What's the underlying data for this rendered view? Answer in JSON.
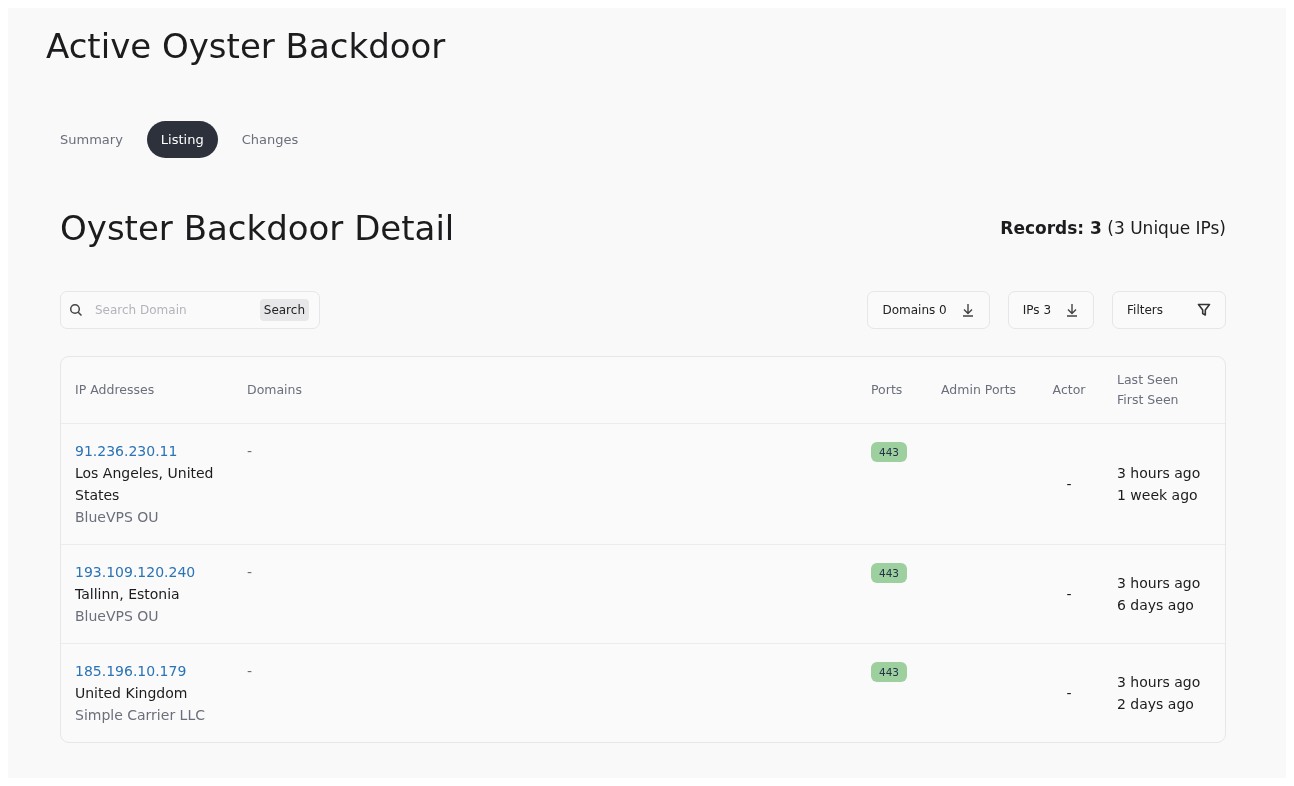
{
  "page_title": "Active Oyster Backdoor",
  "tabs": [
    {
      "label": "Summary",
      "selected": false
    },
    {
      "label": "Listing",
      "selected": true
    },
    {
      "label": "Changes",
      "selected": false
    }
  ],
  "section_title": "Oyster Backdoor Detail",
  "records": "**Records: 3** (3 Unique IPs)",
  "search": {
    "placeholder": "Search Domain",
    "button": "Search"
  },
  "actions": [
    {
      "label": "Domains 0",
      "kind": "download"
    },
    {
      "label": "IPs 3",
      "kind": "download"
    },
    {
      "label": "Filters",
      "kind": "filter"
    }
  ],
  "table": {
    "columns": [
      {
        "label": "IP Addresses"
      },
      {
        "label": "Domains"
      },
      {
        "label": "Ports"
      },
      {
        "label": "Admin Ports"
      },
      {
        "label": "Actor"
      },
      {
        "label": "Last Seen",
        "sublabel": "First Seen"
      }
    ],
    "rows": [
      {
        "ip": "91.236.230.11",
        "location": "Los Angeles, United States",
        "provider": "BlueVPS OU",
        "domains": "-",
        "ports": [
          "443"
        ],
        "actor": "-",
        "last_seen": "3 hours ago",
        "first_seen": "1 week ago"
      },
      {
        "ip": "193.109.120.240",
        "location": "Tallinn, Estonia",
        "provider": "BlueVPS OU",
        "domains": "-",
        "ports": [
          "443"
        ],
        "actor": "-",
        "last_seen": "3 hours ago",
        "first_seen": "6 days ago"
      },
      {
        "ip": "185.196.10.179",
        "location": "United Kingdom",
        "provider": "Simple Carrier LLC",
        "domains": "-",
        "ports": [
          "443"
        ],
        "actor": "-",
        "last_seen": "3 hours ago",
        "first_seen": "2 days ago"
      }
    ]
  }
}
